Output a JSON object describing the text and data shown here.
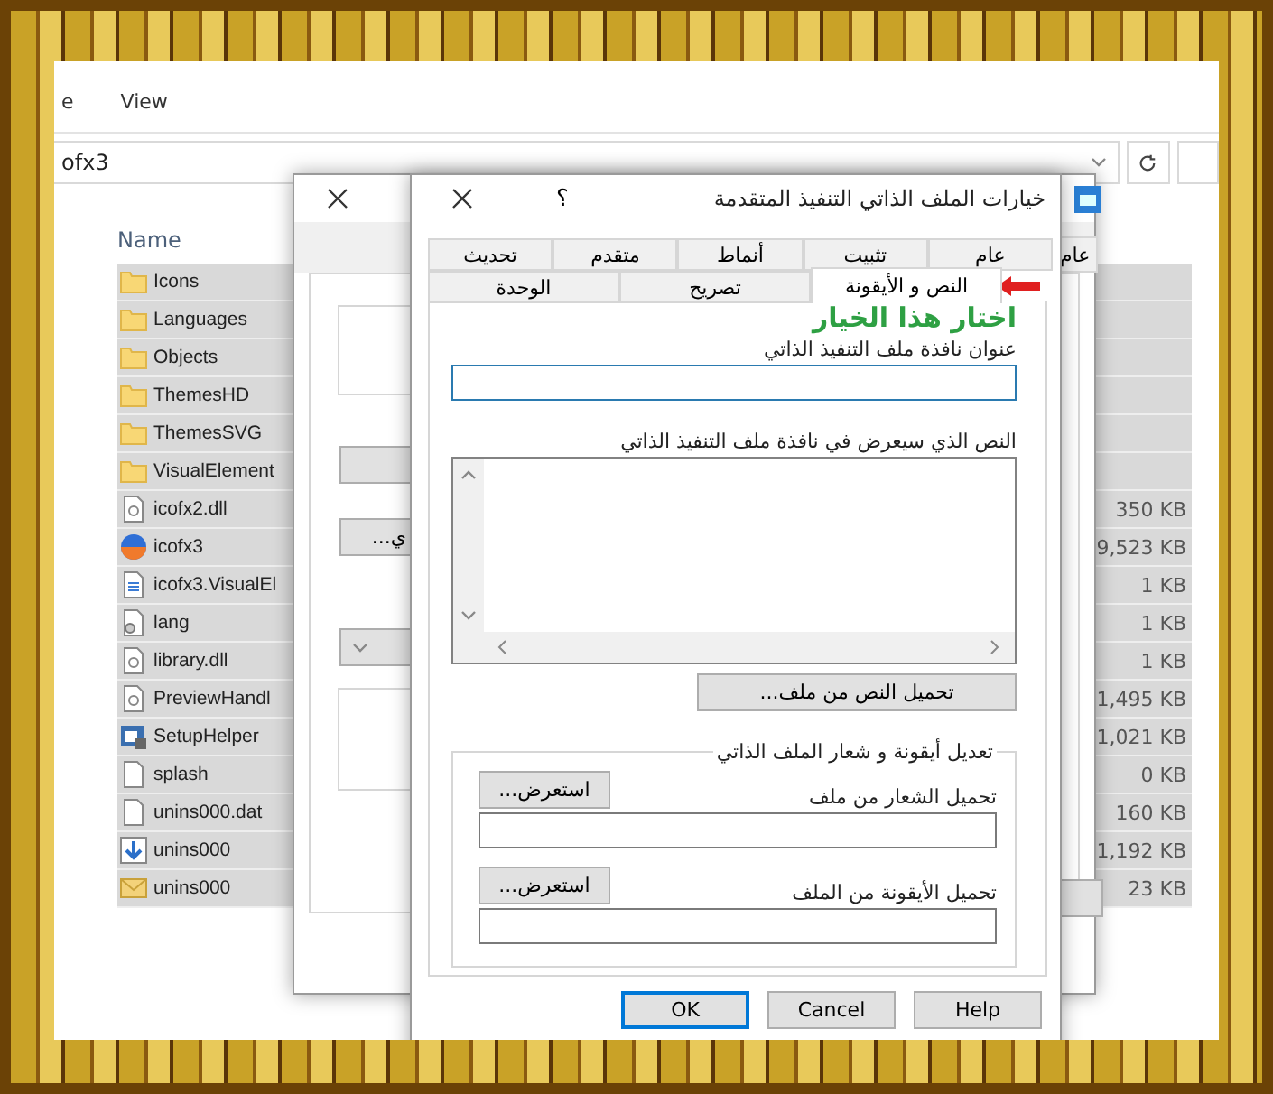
{
  "explorer": {
    "menu_fragment": "e",
    "view_menu": "View",
    "address": "ofx3",
    "column_header": "Name",
    "files": [
      {
        "name": "Icons",
        "kind": "folder",
        "selected": true
      },
      {
        "name": "Languages",
        "kind": "folder",
        "selected": true
      },
      {
        "name": "Objects",
        "kind": "folder",
        "selected": true
      },
      {
        "name": "ThemesHD",
        "kind": "folder",
        "selected": true
      },
      {
        "name": "ThemesSVG",
        "kind": "folder",
        "selected": true
      },
      {
        "name": "VisualElement",
        "kind": "folder",
        "selected": true
      },
      {
        "name": "icofx2.dll",
        "kind": "library",
        "size": "350 KB",
        "selected": true
      },
      {
        "name": "icofx3",
        "kind": "app",
        "size": "9,523 KB",
        "selected": true
      },
      {
        "name": "icofx3.VisualEl",
        "kind": "manifest",
        "size": "1 KB",
        "selected": true
      },
      {
        "name": "lang",
        "kind": "settings",
        "size": "1 KB",
        "selected": true
      },
      {
        "name": "library.dll",
        "kind": "library",
        "size": "1 KB",
        "selected": true
      },
      {
        "name": "PreviewHandl",
        "kind": "library",
        "size": "1,495 KB",
        "selected": true
      },
      {
        "name": "SetupHelper",
        "kind": "setup",
        "size": "1,021 KB",
        "selected": true
      },
      {
        "name": "splash",
        "kind": "blank",
        "size": "0 KB",
        "selected": true
      },
      {
        "name": "unins000.dat",
        "kind": "blank",
        "size": "160 KB",
        "selected": true
      },
      {
        "name": "unins000",
        "kind": "installer",
        "size": "1,192 KB",
        "selected": true
      },
      {
        "name": "unins000",
        "kind": "message",
        "size": "23 KB",
        "selected": true
      }
    ]
  },
  "back_dialog": {
    "button_text": "ي...",
    "tab": "عام"
  },
  "dialog": {
    "title": "خيارات الملف الذاتي التنفيذ المتقدمة",
    "help": "؟",
    "tab_rows": [
      [
        {
          "label": "عام",
          "selected": false
        },
        {
          "label": "تثبيت",
          "selected": false
        },
        {
          "label": "أنماط",
          "selected": false
        },
        {
          "label": "متقدم",
          "selected": false
        },
        {
          "label": "تحديث",
          "selected": false
        }
      ],
      [
        {
          "label": "النص و الأيقونة",
          "selected": true
        },
        {
          "label": "تصريح",
          "selected": false
        },
        {
          "label": "الوحدة",
          "selected": false
        }
      ]
    ],
    "annotation": "اختار هذا الخيار",
    "window_title_label": "عنوان نافذة ملف التنفيذ الذاتي",
    "text_label": "النص الذي سيعرض في نافذة ملف التنفيذ الذاتي",
    "load_text_button": "تحميل النص من ملف...",
    "group": {
      "legend": "تعديل أيقونة و شعار الملف الذاتي",
      "rows": [
        {
          "label": "تحميل الشعار من ملف",
          "button": "استعرض..."
        },
        {
          "label": "تحميل الأيقونة من الملف",
          "button": "استعرض..."
        }
      ]
    },
    "ok_button": {
      "label": "OK",
      "default": true
    },
    "cancel_button": {
      "label": "Cancel",
      "default": false
    },
    "help_button": {
      "label": "Help",
      "default": false
    }
  }
}
